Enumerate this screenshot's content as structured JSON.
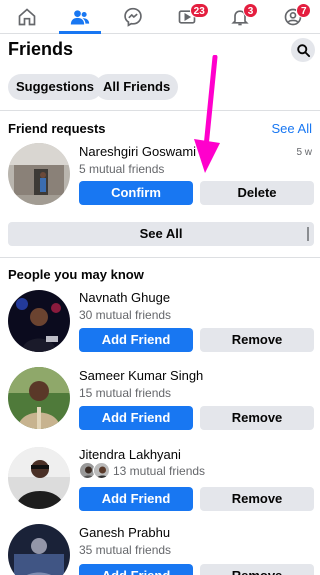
{
  "nav": {
    "items": [
      {
        "id": "home",
        "icon": "home-icon",
        "badge": ""
      },
      {
        "id": "friends",
        "icon": "friends-icon",
        "badge": ""
      },
      {
        "id": "messenger",
        "icon": "messenger-icon",
        "badge": ""
      },
      {
        "id": "watch",
        "icon": "watch-icon",
        "badge": "23"
      },
      {
        "id": "notifications",
        "icon": "bell-icon",
        "badge": "3"
      },
      {
        "id": "menu",
        "icon": "profile-menu-icon",
        "badge": "7"
      }
    ]
  },
  "header": {
    "title": "Friends",
    "search_icon": "search-icon"
  },
  "filters": {
    "suggestions": "Suggestions",
    "all_friends": "All Friends"
  },
  "requests": {
    "title": "Friend requests",
    "see_all_link": "See All",
    "items": [
      {
        "name": "Nareshgiri Goswami",
        "mutual": "5 mutual friends",
        "time": "5 w",
        "confirm": "Confirm",
        "delete": "Delete"
      }
    ],
    "see_all_button": "See All"
  },
  "people": {
    "title": "People you may know",
    "items": [
      {
        "name": "Navnath Ghuge",
        "mutual": "30 mutual friends",
        "add": "Add Friend",
        "remove": "Remove"
      },
      {
        "name": "Sameer Kumar Singh",
        "mutual": "15 mutual friends",
        "add": "Add Friend",
        "remove": "Remove"
      },
      {
        "name": "Jitendra Lakhyani",
        "mutual": "13 mutual friends",
        "add": "Add Friend",
        "remove": "Remove"
      },
      {
        "name": "Ganesh Prabhu",
        "mutual": "35 mutual friends",
        "add": "Add Friend",
        "remove": "Remove"
      }
    ]
  },
  "colors": {
    "accent": "#1877f2",
    "badge": "#e41e3f",
    "arrow": "#ff00cc"
  }
}
